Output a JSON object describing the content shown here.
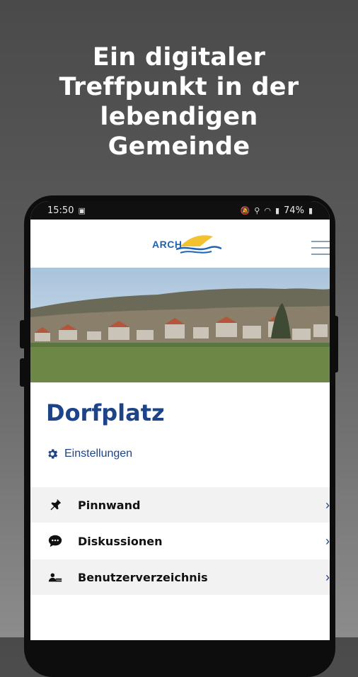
{
  "headline": [
    "Ein digitaler",
    "Treffpunkt in der",
    "lebendigen",
    "Gemeinde"
  ],
  "status_bar": {
    "time": "15:50",
    "battery": "74%"
  },
  "app": {
    "logo_text": "ARCH",
    "page_title": "Dorfplatz",
    "settings_label": "Einstellungen"
  },
  "menu": [
    {
      "label": "Pinnwand",
      "icon": "pin-icon"
    },
    {
      "label": "Diskussionen",
      "icon": "chat-icon"
    },
    {
      "label": "Benutzerverzeichnis",
      "icon": "users-icon"
    }
  ],
  "colors": {
    "accent": "#1d4488",
    "logo_blue": "#1e64b4",
    "logo_yellow": "#f2c230"
  }
}
